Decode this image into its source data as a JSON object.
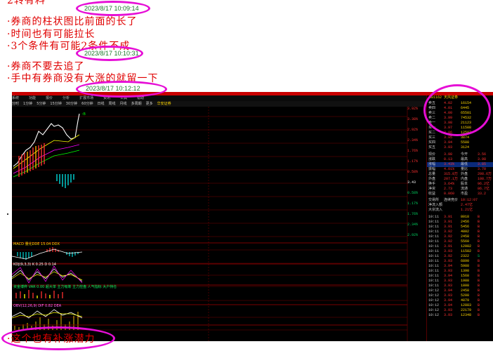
{
  "notes": {
    "top_fragment": "2转有料",
    "line1": "·券商的柱状图比前面的长了",
    "line2": "·时间也有可能拉长",
    "line3": "·3个条件有可能2条件不成",
    "line4": "·券商不要去追了",
    "line5": "·手中有券商没有大涨的就留一下",
    "bottom": "·这个也有补涨潜力"
  },
  "timestamps": {
    "t1": "2023/8/17 10:09:14",
    "t2": "2023/8/17 10:10:31",
    "t3": "2023/8/17 10:12:12"
  },
  "colors": {
    "annotation_ring": "#e60ed6",
    "note_text": "#e00000",
    "up": "#ff3030",
    "down": "#00d8d8",
    "background": "#000000"
  },
  "app": {
    "menu": [
      "系统",
      "功能",
      "报价",
      "分析",
      "扩展市场",
      "资讯",
      "工具",
      "帮助"
    ],
    "tabs": [
      "分时",
      "1分钟",
      "5分钟",
      "15分钟",
      "30分钟",
      "60分钟",
      "日线",
      "周线",
      "月线",
      "多周期",
      "更多"
    ],
    "stock_label": "华安证券",
    "top_right_label": "681162 天风证券"
  },
  "indicators": {
    "macd_label": "MACD 量化DDE 15.04 DDX",
    "kdj_label": "KDJ(9,3,3) K 0.25 D 0.14",
    "flow_label": "资金博弈 VAR 0.00 超大单 主力吸筹 主力控盘 人气指标 大户持仓",
    "obv_label": "OBV(12,26,9) DIF 0.82 DEA"
  },
  "axis_values": [
    "3.92%",
    "3.38%",
    "2.92%",
    "2.34%",
    "1.76%",
    "1.17%",
    "0.58%",
    "3.43",
    "0.58%",
    "1.17%",
    "1.76%",
    "2.34%",
    "2.92%"
  ],
  "orderbook": {
    "sells": [
      [
        "卖五",
        "4.02",
        "16154"
      ],
      [
        "卖四",
        "4.01",
        "6445"
      ],
      [
        "卖三",
        "4.00",
        "65581"
      ],
      [
        "卖二",
        "3.99",
        "74532"
      ],
      [
        "卖一",
        "3.98",
        "21123"
      ]
    ],
    "buys": [
      [
        "买一",
        "3.97",
        "11588"
      ],
      [
        "买二",
        "3.96",
        "12597"
      ],
      [
        "买三",
        "3.95",
        "3874"
      ],
      [
        "买四",
        "3.94",
        "5588"
      ],
      [
        "买五",
        "3.93",
        "3124"
      ]
    ]
  },
  "stats": [
    [
      "现价",
      "3.98",
      "今开",
      "3.56"
    ],
    [
      "涨跌",
      "0.13",
      "最高",
      "3.98"
    ],
    [
      "涨幅",
      "3.43%",
      "最低",
      "3.85"
    ],
    [
      "振幅",
      "4.01%",
      "量比",
      "3.70"
    ],
    [
      "总量",
      "315.8万",
      "外盘",
      "208.6万"
    ],
    [
      "外盘",
      "207.1万",
      "内盘",
      "108.7万"
    ],
    [
      "换手",
      "3.64%",
      "股本",
      "96.2亿"
    ],
    [
      "净资",
      "2.73",
      "流通",
      "86.7亿"
    ],
    [
      "收益",
      "0.060",
      "市盈",
      "33.2"
    ]
  ],
  "flow_rows": [
    [
      "交易所",
      "连续竞价",
      "10:12:07"
    ],
    [
      "净流入额",
      "",
      "2.47亿"
    ],
    [
      "大宗流入",
      "",
      "1.21亿"
    ]
  ],
  "ticks": [
    [
      "10:11",
      "3.91",
      "8018",
      "B"
    ],
    [
      "10:11",
      "3.91",
      "2456",
      "B"
    ],
    [
      "10:11",
      "3.91",
      "5456",
      "B"
    ],
    [
      "10:11",
      "3.92",
      "4802",
      "B"
    ],
    [
      "10:11",
      "3.92",
      "2458",
      "B"
    ],
    [
      "10:11",
      "3.92",
      "5560",
      "B"
    ],
    [
      "10:11",
      "3.91",
      "12082",
      "B"
    ],
    [
      "10:11",
      "3.93",
      "11582",
      "B"
    ],
    [
      "10:11",
      "3.92",
      "2322",
      "S"
    ],
    [
      "10:11",
      "3.93",
      "6890",
      "B"
    ],
    [
      "10:11",
      "3.94",
      "5988",
      "B"
    ],
    [
      "10:11",
      "3.93",
      "1398",
      "B"
    ],
    [
      "10:11",
      "3.94",
      "1568",
      "B"
    ],
    [
      "10:11",
      "3.93",
      "1988",
      "B"
    ],
    [
      "10:11",
      "3.93",
      "1808",
      "B"
    ],
    [
      "10:12",
      "3.94",
      "2458",
      "B"
    ],
    [
      "10:12",
      "3.93",
      "5208",
      "B"
    ],
    [
      "10:12",
      "3.94",
      "4879",
      "B"
    ],
    [
      "10:12",
      "3.94",
      "12883",
      "B"
    ],
    [
      "10:12",
      "3.93",
      "22179",
      "B"
    ],
    [
      "10:12",
      "3.93",
      "12348",
      "B"
    ]
  ]
}
